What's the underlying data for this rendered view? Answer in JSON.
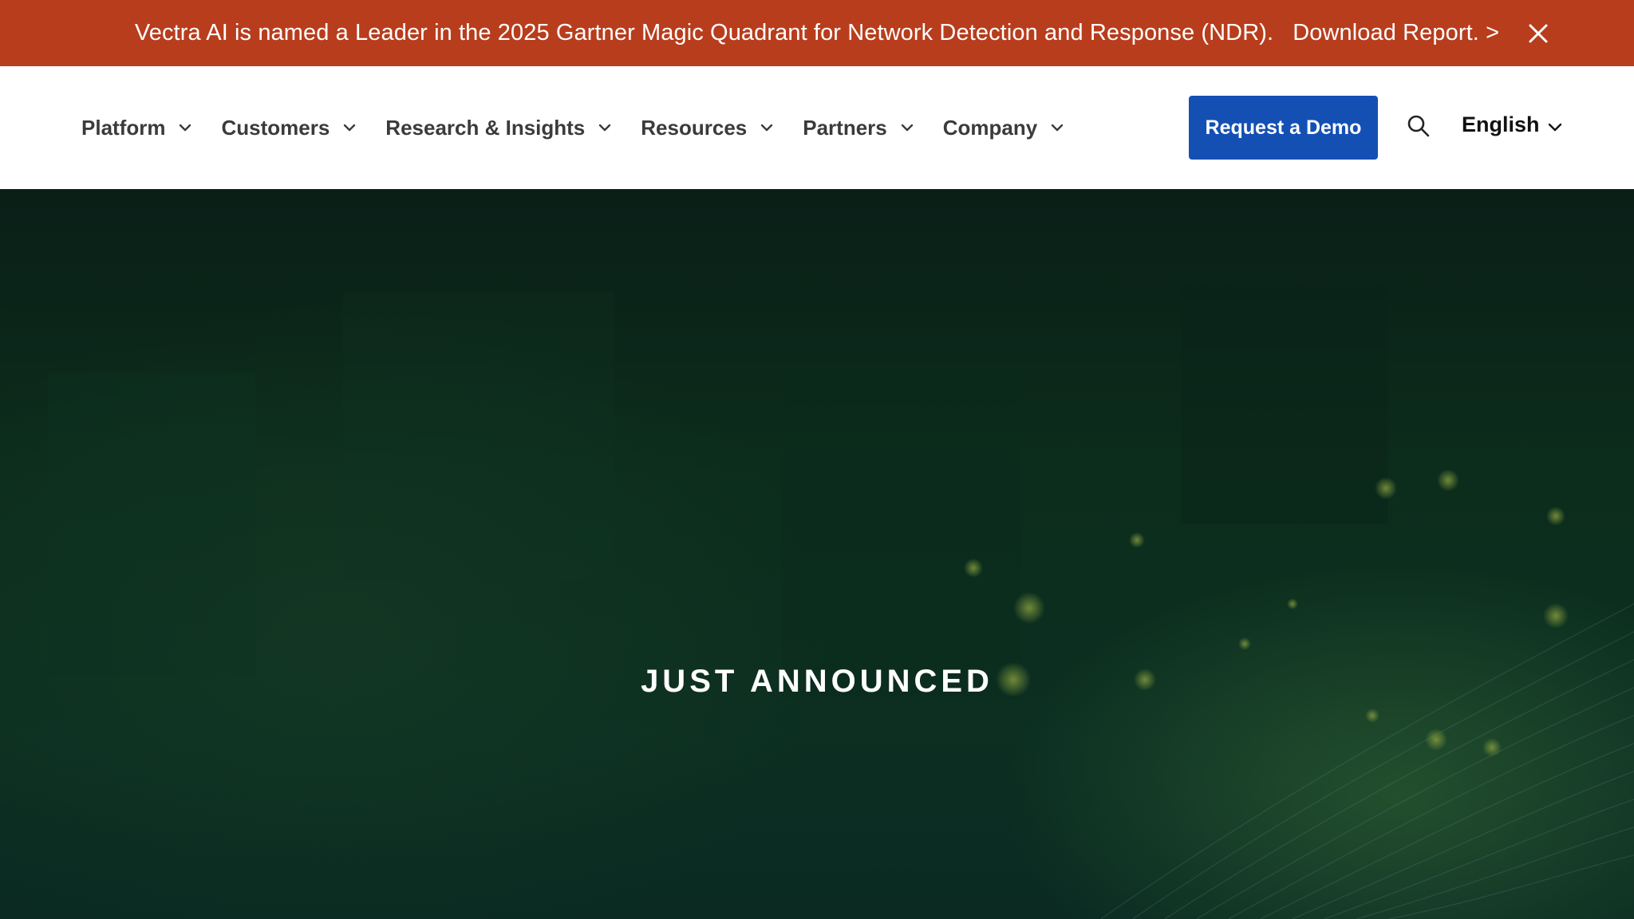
{
  "banner": {
    "message": "Vectra AI is named a Leader in the 2025 Gartner Magic Quadrant for Network Detection and Response (NDR).",
    "link_label": "Download Report. >",
    "close_icon": "close-icon",
    "background": "#b83d1d"
  },
  "nav": {
    "items": [
      {
        "label": "Platform"
      },
      {
        "label": "Customers"
      },
      {
        "label": "Research & Insights"
      },
      {
        "label": "Resources"
      },
      {
        "label": "Partners"
      },
      {
        "label": "Company"
      }
    ],
    "demo_label": "Request a Demo",
    "demo_color": "#1450b4",
    "search_icon": "search-icon",
    "language": "English"
  },
  "hero": {
    "eyebrow": "JUST ANNOUNCED"
  }
}
